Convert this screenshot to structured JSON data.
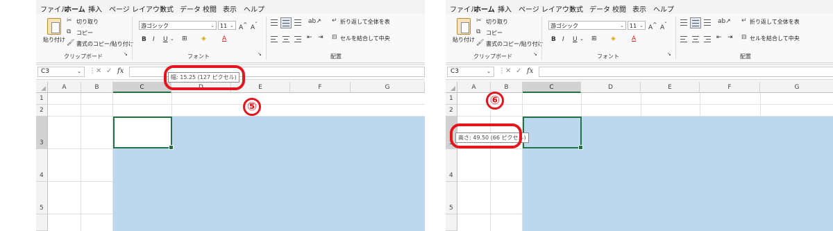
{
  "menu": [
    "ファイル",
    "ホーム",
    "挿入",
    "ページ レイアウト",
    "数式",
    "データ",
    "校閲",
    "表示",
    "ヘルプ"
  ],
  "active_menu": "ホーム",
  "ribbon": {
    "paste": "貼り付け",
    "cut": "切り取り",
    "copy": "コピー",
    "format_painter": "書式のコピー/貼り付け",
    "clipboard_group": "クリップボード",
    "font_name": "游ゴシック",
    "font_size": "11",
    "font_group": "フォント",
    "wrap_text": "折り返して全体を表",
    "merge_center": "セルを結合して中央",
    "align_group": "配置"
  },
  "formula_bar": {
    "name_box": "C3",
    "fx": "fx"
  },
  "columns": [
    "A",
    "B",
    "C",
    "D",
    "E",
    "F",
    "G"
  ],
  "rows": [
    "1",
    "2",
    "3",
    "4",
    "5"
  ],
  "panel1": {
    "tooltip": "幅: 15.25 (127 ピクセル)",
    "step": "⑤"
  },
  "panel2": {
    "tooltip": "高さ: 49.50 (66 ピクセル)",
    "step": "⑥"
  },
  "colors": {
    "selection_blue": "#bdd7ee",
    "excel_green": "#217346",
    "annotation_red": "#e3161d"
  }
}
